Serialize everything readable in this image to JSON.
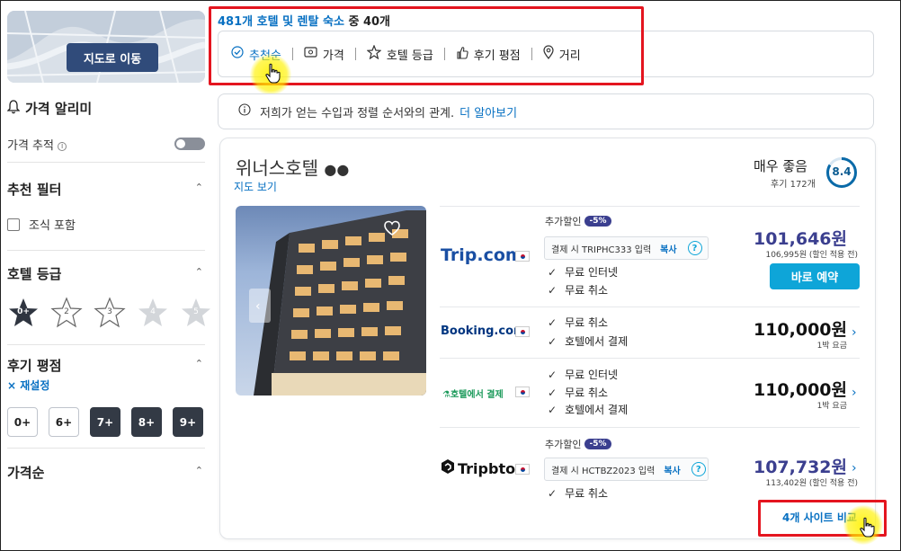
{
  "sidebar": {
    "map_button": "지도로 이동",
    "price_alert_title": "가격 알리미",
    "price_tracking_label": "가격 추적",
    "recommended_filter_title": "추천 필터",
    "breakfast_label": "조식 포함",
    "hotel_class_title": "호텔 등급",
    "hotel_class_options": [
      "0+",
      "2",
      "3",
      "4",
      "5"
    ],
    "review_score_title": "후기 평점",
    "reset_label": "재설정",
    "review_score_options": [
      "0+",
      "6+",
      "7+",
      "8+",
      "9+"
    ],
    "price_sort_title": "가격순"
  },
  "results": {
    "count_link": "481개 호텔 및 렌탈 숙소",
    "count_suffix_a": " 중 ",
    "count_shown": "40개",
    "sort_options": [
      "추천순",
      "가격",
      "호텔 등급",
      "후기 평점",
      "거리"
    ],
    "info_text": "저희가 얻는 수입과 정렬 순서와의 관계.",
    "info_link": "더 알아보기"
  },
  "hotel": {
    "name": "위너스호텔",
    "map_link": "지도 보기",
    "score_label": "매우 좋음",
    "reviews": "후기 172개",
    "score": "8.4",
    "offers": [
      {
        "brand": "Trip.com",
        "extra_label": "추가할인",
        "discount": "-5%",
        "coupon_text": "결제 시 TRIPHC333 입력",
        "copy_label": "복사",
        "features": [
          "무료 인터넷",
          "무료 취소"
        ],
        "price": "101,646원",
        "sub": "106,995원 (할인 적용 전)",
        "button": "바로 예약"
      },
      {
        "brand": "Booking.com",
        "features": [
          "무료 취소",
          "호텔에서 결제"
        ],
        "price": "110,000원",
        "sub": "1박 요금"
      },
      {
        "brand": "호텔에서 결제",
        "features": [
          "무료 인터넷",
          "무료 취소",
          "호텔에서 결제"
        ],
        "price": "110,000원",
        "sub": "1박 요금"
      },
      {
        "brand": "Tripbtoz",
        "extra_label": "추가할인",
        "discount": "-5%",
        "coupon_text": "결제 시 HCTBZ2023 입력",
        "copy_label": "복사",
        "features": [
          "무료 취소"
        ],
        "price": "107,732원",
        "sub": "113,402원 (할인 적용 전)"
      }
    ],
    "compare_link": "4개 사이트 비교"
  },
  "colors": {
    "link": "#0770c2",
    "highlight_box": "#e4151f",
    "cta": "#0ea5d8",
    "discount_price": "#3b3f8f"
  }
}
